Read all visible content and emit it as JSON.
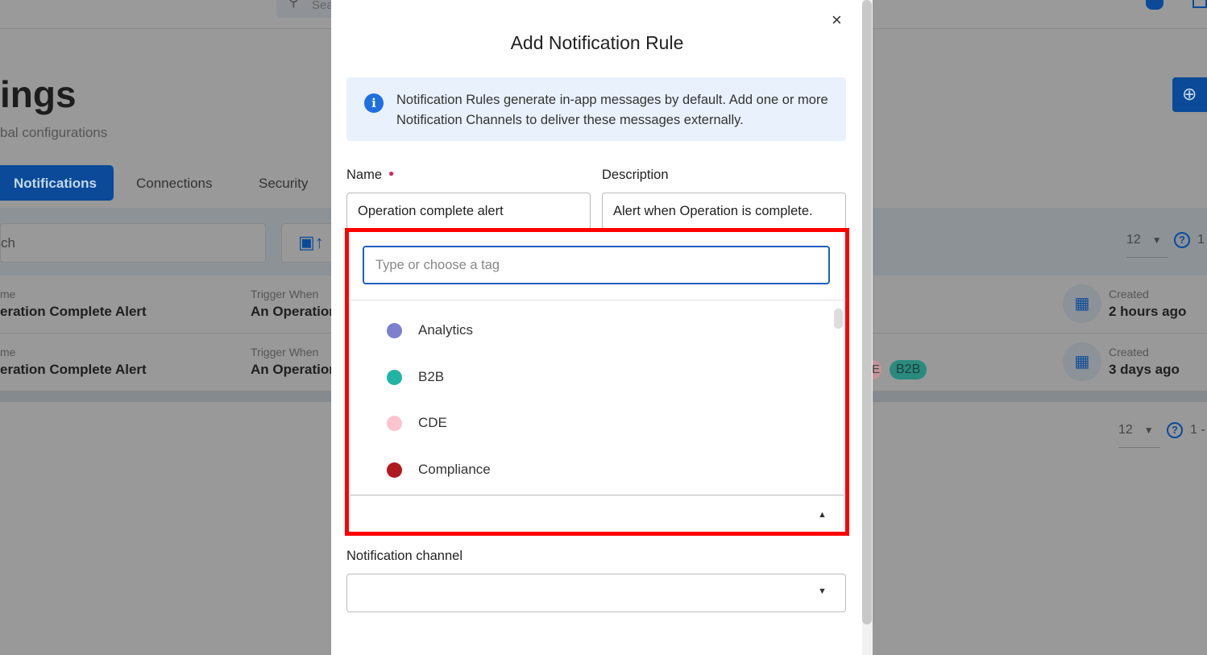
{
  "background": {
    "top_search_placeholder": "Sea",
    "page_title": "ings",
    "page_subtitle": "bal configurations",
    "tabs": [
      {
        "label": "Notifications",
        "active": true
      },
      {
        "label": "Connections"
      },
      {
        "label": "Security"
      }
    ],
    "search_placeholder": "ch",
    "page_size": "12",
    "range_text": "1",
    "range_text_bottom": "1 -",
    "rows": [
      {
        "name_label": "me",
        "name": "eration Complete Alert",
        "trigger_label": "Trigger When",
        "trigger": "An Operation",
        "created_label": "Created",
        "created": "2 hours ago",
        "tags": []
      },
      {
        "name_label": "me",
        "name": "eration Complete Alert",
        "trigger_label": "Trigger When",
        "trigger": "An Operation",
        "created_label": "Created",
        "created": "3 days ago",
        "tags": [
          "E",
          "B2B"
        ]
      }
    ]
  },
  "modal": {
    "title": "Add Notification Rule",
    "close_icon": "×",
    "info_text": "Notification Rules generate in-app messages by default. Add one or more Notification Channels to deliver these messages externally.",
    "name_label": "Name",
    "name_value": "Operation complete alert",
    "description_label": "Description",
    "description_value": "Alert when Operation is complete.",
    "tag_placeholder": "Type or choose a tag",
    "tag_options": [
      {
        "label": "Analytics",
        "color": "#7b80cf"
      },
      {
        "label": "B2B",
        "color": "#22b3a3"
      },
      {
        "label": "CDE",
        "color": "#fbc4cf"
      },
      {
        "label": "Compliance",
        "color": "#b0191f"
      }
    ],
    "channel_label": "Notification channel",
    "channel_value": ""
  },
  "colors": {
    "accent": "#0a4a99",
    "highlight": "#ff0000",
    "required": "#e0245e"
  }
}
